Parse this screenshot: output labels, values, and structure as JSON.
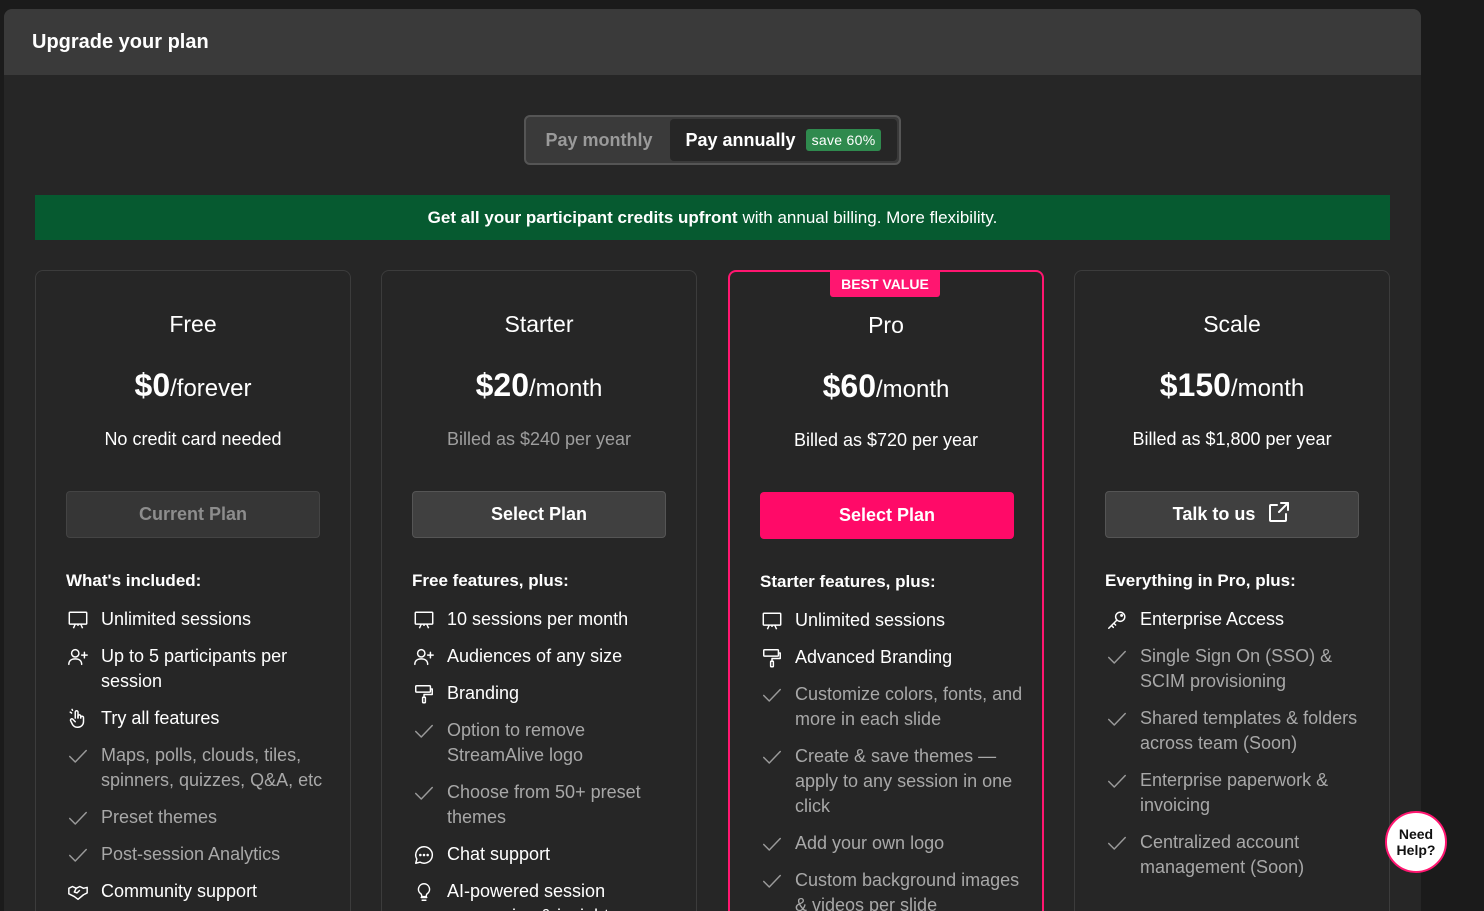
{
  "modal": {
    "title": "Upgrade your plan"
  },
  "billing_toggle": {
    "monthly": "Pay monthly",
    "annually": "Pay annually",
    "save_badge": "save 60%"
  },
  "banner": {
    "bold": "Get all your participant credits upfront",
    "rest": "with annual billing. More flexibility."
  },
  "colors": {
    "accent": "#ff1670",
    "banner": "#065a30",
    "save": "#2f8a4e"
  },
  "plans": [
    {
      "name": "Free",
      "amount": "$0",
      "period": "/forever",
      "billing": "No credit card needed",
      "button": "Current Plan",
      "features_title": "What's included:",
      "features": [
        {
          "text": "Unlimited sessions",
          "icon": "presentation-icon"
        },
        {
          "text": "Up to 5 participants per session",
          "icon": "user-plus-icon"
        },
        {
          "text": "Try all features",
          "icon": "hand-pointer-icon"
        },
        {
          "text": "Maps, polls, clouds, tiles, spinners, quizzes, Q&A, etc",
          "icon": "check-icon"
        },
        {
          "text": "Preset themes",
          "icon": "check-icon"
        },
        {
          "text": "Post-session Analytics",
          "icon": "check-icon"
        },
        {
          "text": "Community support",
          "icon": "handshake-icon"
        }
      ]
    },
    {
      "name": "Starter",
      "amount": "$20",
      "period": "/month",
      "billing": "Billed as $240 per year",
      "button": "Select Plan",
      "features_title": "Free features, plus:",
      "features": [
        {
          "text": "10 sessions per month",
          "icon": "presentation-icon"
        },
        {
          "text": "Audiences of any size",
          "icon": "user-plus-icon"
        },
        {
          "text": "Branding",
          "icon": "paint-roller-icon"
        },
        {
          "text": "Option to remove StreamAlive logo",
          "icon": "check-icon"
        },
        {
          "text": "Choose from 50+ preset themes",
          "icon": "check-icon"
        },
        {
          "text": "Chat support",
          "icon": "chat-bubble-icon"
        },
        {
          "text": "AI-powered session summaries & insights",
          "icon": "lightbulb-icon"
        }
      ]
    },
    {
      "name": "Pro",
      "badge": "BEST VALUE",
      "amount": "$60",
      "period": "/month",
      "billing": "Billed as $720 per year",
      "button": "Select Plan",
      "features_title": "Starter features, plus:",
      "features": [
        {
          "text": "Unlimited sessions",
          "icon": "presentation-icon"
        },
        {
          "text": "Advanced Branding",
          "icon": "paint-roller-icon"
        },
        {
          "text": "Customize colors, fonts, and more in each slide",
          "icon": "check-icon"
        },
        {
          "text": "Create & save themes — apply to any session in one click",
          "icon": "check-icon"
        },
        {
          "text": "Add your own logo",
          "icon": "check-icon"
        },
        {
          "text": "Custom background images & videos per slide",
          "icon": "check-icon"
        }
      ]
    },
    {
      "name": "Scale",
      "amount": "$150",
      "period": "/month",
      "billing": "Billed as $1,800 per year",
      "button": "Talk to us",
      "features_title": "Everything in Pro, plus:",
      "features": [
        {
          "text": "Enterprise Access",
          "icon": "key-icon"
        },
        {
          "text": "Single Sign On (SSO) & SCIM provisioning",
          "icon": "check-icon"
        },
        {
          "text": "Shared templates & folders across team (Soon)",
          "icon": "check-icon"
        },
        {
          "text": "Enterprise paperwork & invoicing",
          "icon": "check-icon"
        },
        {
          "text": "Centralized account management (Soon)",
          "icon": "check-icon"
        }
      ]
    }
  ],
  "help": {
    "label": "Need Help?"
  }
}
